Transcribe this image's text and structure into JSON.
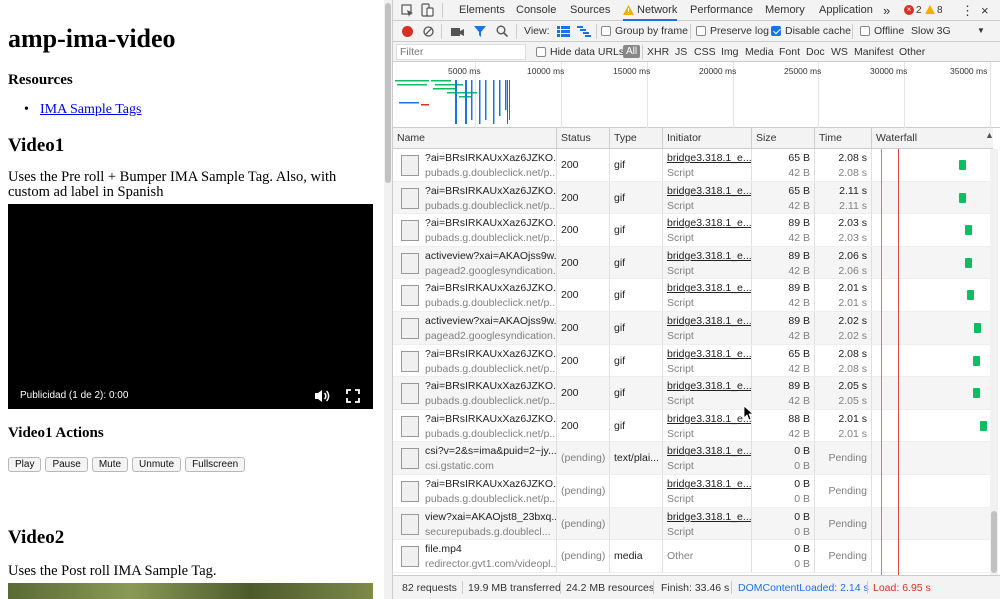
{
  "page": {
    "title": "amp-ima-video",
    "resources_heading": "Resources",
    "resources_link": "IMA Sample Tags",
    "video1_heading": "Video1",
    "video1_desc": "Uses the Pre roll + Bumper IMA Sample Tag. Also, with custom ad label in Spanish",
    "ad_label": "Publicidad (1 de 2): 0:00",
    "actions_heading": "Video1 Actions",
    "buttons": [
      "Play",
      "Pause",
      "Mute",
      "Unmute",
      "Fullscreen"
    ],
    "video2_heading": "Video2",
    "video2_desc": "Uses the Post roll IMA Sample Tag."
  },
  "devtools": {
    "tabs": [
      "Elements",
      "Console",
      "Sources",
      "Network",
      "Performance",
      "Memory",
      "Application"
    ],
    "active_tab": "Network",
    "errors": "2",
    "warnings": "8",
    "toolbar": {
      "view_label": "View:",
      "group_by_frame": "Group by frame",
      "preserve_log": "Preserve log",
      "disable_cache": "Disable cache",
      "offline": "Offline",
      "throttle": "Slow 3G"
    },
    "filter": {
      "placeholder": "Filter",
      "hide_data_urls": "Hide data URLs",
      "types": [
        "All",
        "XHR",
        "JS",
        "CSS",
        "Img",
        "Media",
        "Font",
        "Doc",
        "WS",
        "Manifest",
        "Other"
      ]
    },
    "overview_ticks": [
      "5000 ms",
      "10000 ms",
      "15000 ms",
      "20000 ms",
      "25000 ms",
      "30000 ms",
      "35000 ms"
    ],
    "columns": [
      "Name",
      "Status",
      "Type",
      "Initiator",
      "Size",
      "Time",
      "Waterfall"
    ],
    "rows": [
      {
        "name": "?ai=BRsIRKAUxXaz6JZKO...",
        "domain": "pubads.g.doubleclick.net/p...",
        "status": "200",
        "type": "gif",
        "initiator": "bridge3.318.1_e...",
        "init_sub": "Script",
        "size": "65 B",
        "size2": "42 B",
        "time": "2.08 s",
        "time2": "2.08 s",
        "wf": 0.78
      },
      {
        "name": "?ai=BRsIRKAUxXaz6JZKO...",
        "domain": "pubads.g.doubleclick.net/p...",
        "status": "200",
        "type": "gif",
        "initiator": "bridge3.318.1_e...",
        "init_sub": "Script",
        "size": "65 B",
        "size2": "42 B",
        "time": "2.11 s",
        "time2": "2.11 s",
        "wf": 0.78
      },
      {
        "name": "?ai=BRsIRKAUxXaz6JZKO...",
        "domain": "pubads.g.doubleclick.net/p...",
        "status": "200",
        "type": "gif",
        "initiator": "bridge3.318.1_e...",
        "init_sub": "Script",
        "size": "89 B",
        "size2": "42 B",
        "time": "2.03 s",
        "time2": "2.03 s",
        "wf": 0.83
      },
      {
        "name": "activeview?xai=AKAOjss9w...",
        "domain": "pagead2.googlesyndication...",
        "status": "200",
        "type": "gif",
        "initiator": "bridge3.318.1_e...",
        "init_sub": "Script",
        "size": "89 B",
        "size2": "42 B",
        "time": "2.06 s",
        "time2": "2.06 s",
        "wf": 0.83
      },
      {
        "name": "?ai=BRsIRKAUxXaz6JZKO...",
        "domain": "pubads.g.doubleclick.net/p...",
        "status": "200",
        "type": "gif",
        "initiator": "bridge3.318.1_e...",
        "init_sub": "Script",
        "size": "89 B",
        "size2": "42 B",
        "time": "2.01 s",
        "time2": "2.01 s",
        "wf": 0.85
      },
      {
        "name": "activeview?xai=AKAOjss9w...",
        "domain": "pagead2.googlesyndication...",
        "status": "200",
        "type": "gif",
        "initiator": "bridge3.318.1_e...",
        "init_sub": "Script",
        "size": "89 B",
        "size2": "42 B",
        "time": "2.02 s",
        "time2": "2.02 s",
        "wf": 0.91
      },
      {
        "name": "?ai=BRsIRKAUxXaz6JZKO...",
        "domain": "pubads.g.doubleclick.net/p...",
        "status": "200",
        "type": "gif",
        "initiator": "bridge3.318.1_e...",
        "init_sub": "Script",
        "size": "65 B",
        "size2": "42 B",
        "time": "2.08 s",
        "time2": "2.08 s",
        "wf": 0.9
      },
      {
        "name": "?ai=BRsIRKAUxXaz6JZKO...",
        "domain": "pubads.g.doubleclick.net/p...",
        "status": "200",
        "type": "gif",
        "initiator": "bridge3.318.1_e...",
        "init_sub": "Script",
        "size": "89 B",
        "size2": "42 B",
        "time": "2.05 s",
        "time2": "2.05 s",
        "wf": 0.9
      },
      {
        "name": "?ai=BRsIRKAUxXaz6JZKO...",
        "domain": "pubads.g.doubleclick.net/p...",
        "status": "200",
        "type": "gif",
        "initiator": "bridge3.318.1_e...",
        "init_sub": "Script",
        "size": "88 B",
        "size2": "42 B",
        "time": "2.01 s",
        "time2": "2.01 s",
        "wf": 0.96
      },
      {
        "name": "csi?v=2&s=ima&puid=2~jy...",
        "domain": "csi.gstatic.com",
        "status": "(pending)",
        "type": "text/plai...",
        "initiator": "bridge3.318.1_e...",
        "init_sub": "Script",
        "size": "0 B",
        "size2": "0 B",
        "time": "Pending",
        "time2": "",
        "wf": null
      },
      {
        "name": "?ai=BRsIRKAUxXaz6JZKO...",
        "domain": "pubads.g.doubleclick.net/p...",
        "status": "(pending)",
        "type": "",
        "initiator": "bridge3.318.1_e...",
        "init_sub": "Script",
        "size": "0 B",
        "size2": "0 B",
        "time": "Pending",
        "time2": "",
        "wf": null
      },
      {
        "name": "view?xai=AKAOjst8_23bxq...",
        "domain": "securepubads.g.doublecl...",
        "status": "(pending)",
        "type": "",
        "initiator": "bridge3.318.1_e...",
        "init_sub": "Script",
        "size": "0 B",
        "size2": "0 B",
        "time": "Pending",
        "time2": "",
        "wf": null
      },
      {
        "name": "file.mp4",
        "domain": "redirector.gvt1.com/videopl...",
        "status": "(pending)",
        "type": "media",
        "initiator": "Other",
        "init_sub": "",
        "size": "0 B",
        "size2": "0 B",
        "time": "Pending",
        "time2": "",
        "wf": null
      }
    ],
    "status_bar": {
      "requests": "82 requests",
      "transferred": "19.9 MB transferred",
      "resources": "24.2 MB resources",
      "finish": "Finish: 33.46 s",
      "dcl": "DOMContentLoaded: 2.14 s",
      "load": "Load: 6.95 s"
    },
    "colors": {
      "accent": "#1a73e8",
      "dcl": "#1a73e8",
      "load": "#d93025",
      "bar": "#0cbd62",
      "record": "#d93025"
    }
  }
}
